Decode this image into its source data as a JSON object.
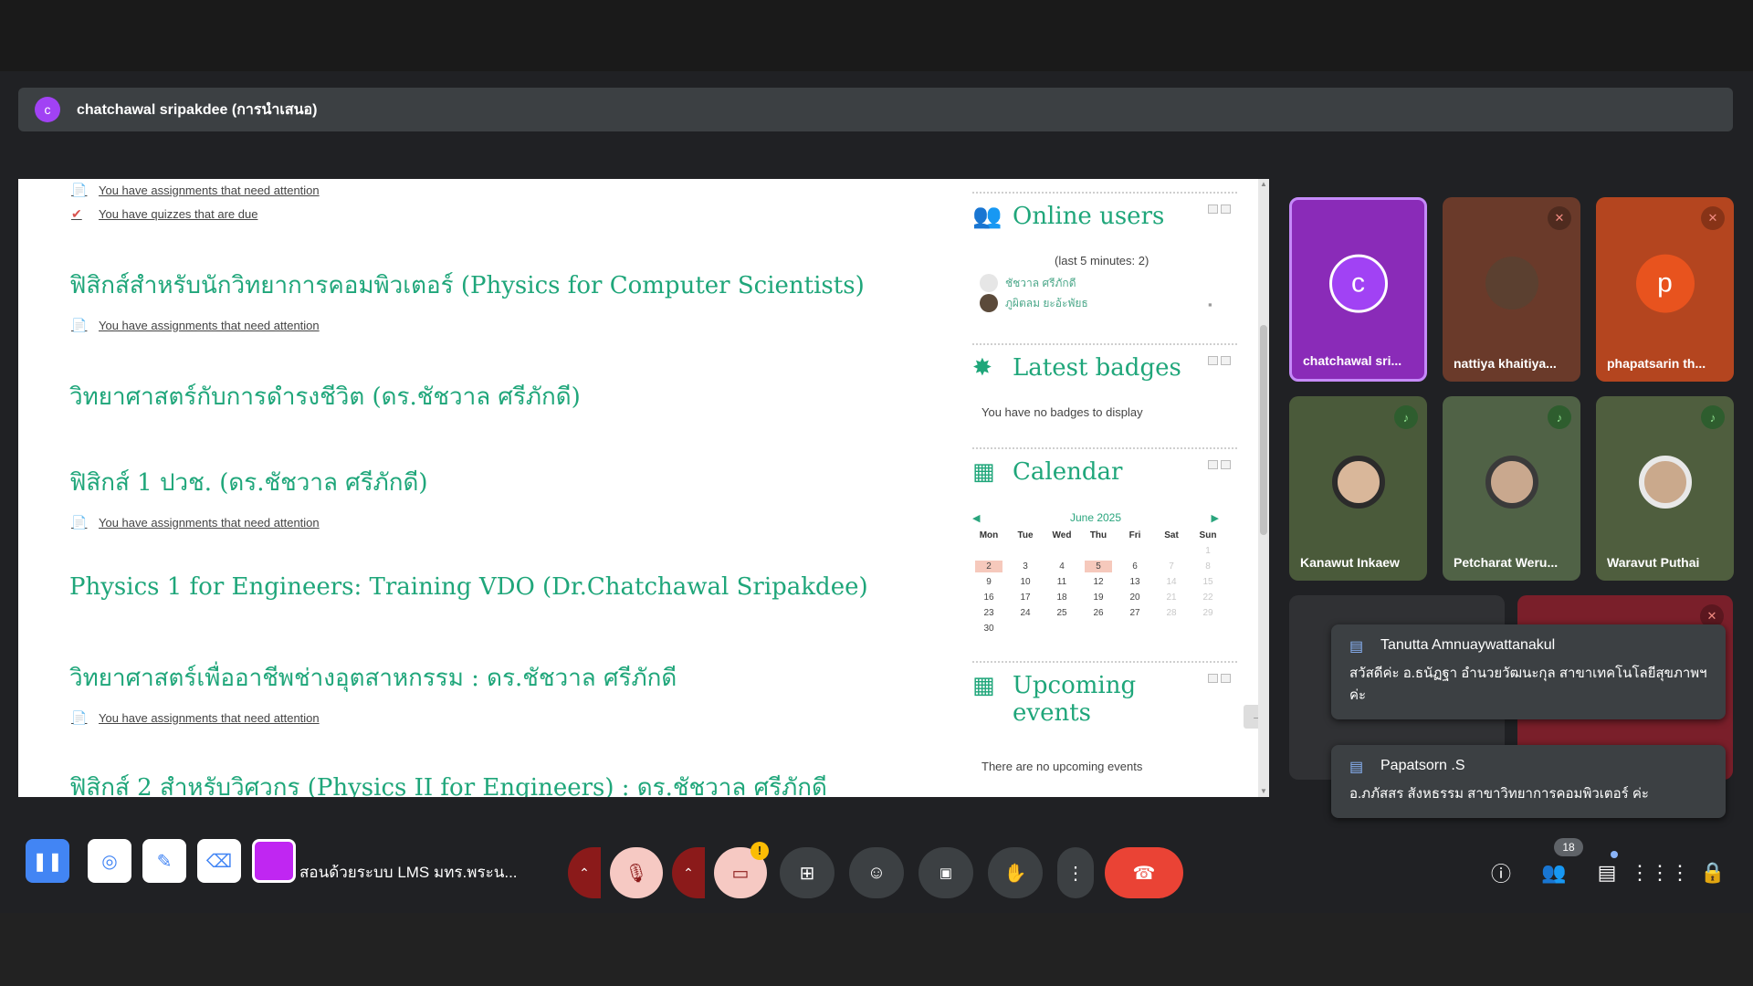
{
  "presenter": {
    "initial": "c",
    "label": "chatchawal sripakdee (การนำเสนอ)"
  },
  "courses": {
    "notice_assignments": "You have assignments that need attention",
    "notice_quizzes": "You have quizzes that are due",
    "titles": [
      "ฟิสิกส์สำหรับนักวิทยาการคอมพิวเตอร์ (Physics for Computer Scientists)",
      "วิทยาศาสตร์กับการดำรงชีวิต (ดร.ชัชวาล ศรีภักดี)",
      "ฟิสิกส์ 1 ปวช. (ดร.ชัชวาล ศรีภักดี)",
      "Physics 1 for Engineers: Training VDO (Dr.Chatchawal Sripakdee)",
      "วิทยาศาสตร์เพื่ออาชีพช่างอุตสาหกรรม : ดร.ชัชวาล ศรีภักดี",
      "ฟิสิกส์ 2 สำหรับวิศวกร (Physics II for Engineers) : ดร.ชัชวาล ศรีภักดี"
    ]
  },
  "blocks": {
    "online": {
      "title": "Online users",
      "subtitle": "(last 5 minutes: 2)",
      "users": [
        "ชัชวาล ศรีภักดี",
        "ภูผิตลม ยะอ้ะพัยธ"
      ]
    },
    "badges": {
      "title": "Latest badges",
      "empty": "You have no badges to display"
    },
    "calendar": {
      "title": "Calendar",
      "month": "June 2025",
      "days": [
        "Mon",
        "Tue",
        "Wed",
        "Thu",
        "Fri",
        "Sat",
        "Sun"
      ],
      "weeks": [
        [
          "",
          "",
          "",
          "",
          "",
          "",
          "1"
        ],
        [
          "2",
          "3",
          "4",
          "5",
          "6",
          "7",
          "8"
        ],
        [
          "9",
          "10",
          "11",
          "12",
          "13",
          "14",
          "15"
        ],
        [
          "16",
          "17",
          "18",
          "19",
          "20",
          "21",
          "22"
        ],
        [
          "23",
          "24",
          "25",
          "26",
          "27",
          "28",
          "29"
        ],
        [
          "30",
          "",
          "",
          "",
          "",
          "",
          ""
        ]
      ],
      "highlighted": [
        "2",
        "5"
      ]
    },
    "upcoming": {
      "title_line1": "Upcoming",
      "title_line2": "events",
      "empty": "There are no upcoming events"
    }
  },
  "participants": [
    {
      "name": "chatchawal sri...",
      "initial": "c",
      "bg": "#8a2bb8",
      "avatar_bg": "#a142f4",
      "muted": false
    },
    {
      "name": "nattiya khaitiya...",
      "bg": "#6a3a2a",
      "muted": true,
      "face": "#5b4030"
    },
    {
      "name": "phapatsarin th...",
      "initial": "p",
      "bg": "#b4451f",
      "avatar_bg": "#e8531e",
      "muted": true
    },
    {
      "name": "Kanawut Inkaew",
      "bg": "#4a5a3a",
      "speaking": true,
      "face": "#d9b79a"
    },
    {
      "name": "Petcharat Weru...",
      "bg": "#506246",
      "speaking": true,
      "face": "#c9a88e"
    },
    {
      "name": "Waravut Puthai",
      "bg": "#4f5e3e",
      "speaking": true,
      "face": "#caa98c"
    }
  ],
  "chat": [
    {
      "name": "Tanutta Amnuaywattanakul",
      "text": "สวัสดีค่ะ อ.ธนัฏฐา อำนวยวัฒนะกุล สาขาเทคโนโลยีสุขภาพฯ ค่ะ"
    },
    {
      "name": "Papatsorn .S",
      "text": "อ.ภภัสสร สังหธรรม สาขาวิทยาการคอมพิวเตอร์ ค่ะ"
    }
  ],
  "toolbar": {
    "meeting_title": "สอนด้วยระบบ LMS มทร.พระน...",
    "participant_count": "18",
    "warning": "!"
  },
  "colors": {
    "accent_green": "#1fa67a",
    "end_call": "#ea4335",
    "muted_red": "#8b1a1a",
    "presenter_purple": "#a142f4"
  }
}
